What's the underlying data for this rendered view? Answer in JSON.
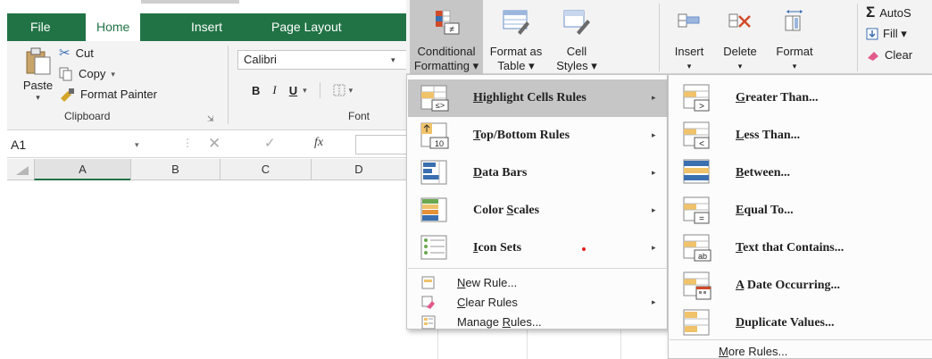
{
  "tabs": [
    {
      "label": "File",
      "active": false
    },
    {
      "label": "Home",
      "active": true
    },
    {
      "label": "Insert",
      "active": false
    },
    {
      "label": "Page Layout",
      "active": false
    }
  ],
  "clipboard": {
    "paste": "Paste",
    "cut": "Cut",
    "copy": "Copy",
    "format_painter": "Format Painter",
    "group_label": "Clipboard"
  },
  "font": {
    "font_name": "Calibri",
    "bold": "B",
    "italic": "I",
    "underline": "U",
    "group_label": "Font"
  },
  "formula_bar": {
    "name_box": "A1",
    "cancel": "✕",
    "enter": "✓",
    "fx": "fx"
  },
  "columns": [
    "A",
    "B",
    "C",
    "D"
  ],
  "styles": {
    "conditional_formatting": [
      "Conditional",
      "Formatting ▾"
    ],
    "format_as_table": [
      "Format as",
      "Table ▾"
    ],
    "cell_styles": [
      "Cell",
      "Styles ▾"
    ]
  },
  "cells": {
    "insert": "Insert",
    "delete": "Delete",
    "format": "Format",
    "dropdown_glyph": "▾"
  },
  "editing": {
    "autosum": "AutoS",
    "fill": "Fill ▾",
    "clear": "Clear"
  },
  "cf_menu": {
    "items": [
      {
        "label": "Highlight Cells Rules",
        "hotkey": "H",
        "rest": "ighlight Cells Rules",
        "highlighted": true,
        "icon": "highlight-cells-icon"
      },
      {
        "label": "Top/Bottom Rules",
        "hotkey": "T",
        "rest": "op/Bottom Rules",
        "highlighted": false,
        "icon": "top-bottom-icon"
      },
      {
        "label": "Data Bars",
        "hotkey": "D",
        "rest": "ata Bars",
        "highlighted": false,
        "icon": "data-bars-icon"
      },
      {
        "label": "Color Scales",
        "pre": "Color ",
        "hotkey": "S",
        "rest": "cales",
        "highlighted": false,
        "icon": "color-scales-icon"
      },
      {
        "label": "Icon Sets",
        "hotkey": "I",
        "rest": "con Sets",
        "highlighted": false,
        "icon": "icon-sets-icon"
      }
    ],
    "new_rule": {
      "hotkey": "N",
      "rest": "ew Rule..."
    },
    "clear_rules": {
      "hotkey": "C",
      "rest": "lear Rules"
    },
    "manage_rules": {
      "pre": "Manage ",
      "hotkey": "R",
      "rest": "ules..."
    },
    "arrow": "▸"
  },
  "highlight_submenu": {
    "items": [
      {
        "hotkey": "G",
        "rest": "reater Than...",
        "icon": "greater-than-icon"
      },
      {
        "hotkey": "L",
        "rest": "ess Than...",
        "icon": "less-than-icon"
      },
      {
        "hotkey": "B",
        "rest": "etween...",
        "icon": "between-icon"
      },
      {
        "hotkey": "E",
        "rest": "qual To...",
        "icon": "equal-to-icon"
      },
      {
        "hotkey": "T",
        "rest": "ext that Contains...",
        "icon": "text-contains-icon"
      },
      {
        "pre": "",
        "hotkey": "A",
        "rest": " Date Occurring...",
        "icon": "date-occurring-icon"
      },
      {
        "hotkey": "D",
        "rest": "uplicate Values...",
        "icon": "duplicate-values-icon"
      }
    ],
    "more_rules": {
      "hotkey": "M",
      "rest": "ore Rules..."
    }
  },
  "colors": {
    "excel_green": "#217346",
    "ribbon_bg": "#f3f3f3",
    "menu_highlight": "#c6c6c6"
  }
}
